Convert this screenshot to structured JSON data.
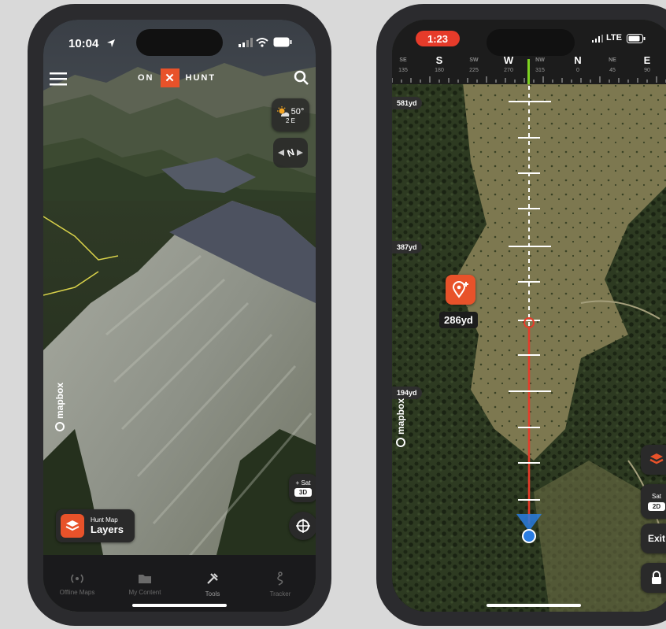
{
  "phone_left": {
    "status": {
      "time": "10:04"
    },
    "header": {
      "logo_left": "ON",
      "logo_x": "✕",
      "logo_right": "HUNT"
    },
    "weather": {
      "temp": "50°",
      "wind": "2 E"
    },
    "compass": {
      "letter": "N"
    },
    "sat_button": {
      "label": "+ Sat",
      "value": "3D"
    },
    "layers": {
      "sublabel": "Hunt Map",
      "label": "Layers"
    },
    "mapbox": "mapbox",
    "nav": [
      {
        "label": "Offline Maps"
      },
      {
        "label": "My Content"
      },
      {
        "label": "Tools"
      },
      {
        "label": "Tracker"
      }
    ]
  },
  "phone_right": {
    "status": {
      "time": "1:23",
      "network": "LTE"
    },
    "compass_strip": {
      "letters": [
        "SE",
        "S",
        "SW",
        "W",
        "NW",
        "N",
        "NE",
        "E"
      ],
      "degrees": [
        "135",
        "180",
        "225",
        "270",
        "315",
        "0",
        "45",
        "90"
      ]
    },
    "distances": [
      "581yd",
      "387yd",
      "194yd"
    ],
    "waypoint": {
      "distance": "286yd"
    },
    "mapbox": "mapbox",
    "sat_button": {
      "label": "Sat",
      "value": "2D"
    },
    "exit_label": "Exit"
  },
  "colors": {
    "accent": "#e8522a",
    "line": "#e63b2a",
    "compass_marker": "#7ed321",
    "location": "#2a7de1"
  }
}
